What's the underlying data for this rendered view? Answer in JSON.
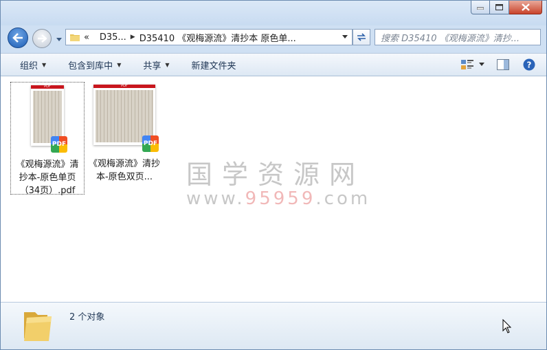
{
  "window": {
    "minimize_icon": "minimize-icon",
    "maximize_icon": "maximize-icon",
    "close_icon": "close-icon"
  },
  "nav": {
    "breadcrumb_overflow": "«",
    "crumb_1": "D35...",
    "crumb_2": "D35410 《观梅源流》清抄本 原色单...",
    "search_placeholder": "搜索 D35410 《观梅源流》清抄..."
  },
  "toolbar": {
    "organize": "组织",
    "include_library": "包含到库中",
    "share": "共享",
    "new_folder": "新建文件夹"
  },
  "files": [
    {
      "name": "《观梅源流》清抄本-原色单页（34页）.pdf",
      "badge": "PDF",
      "thumb_header": "PDF"
    },
    {
      "name": "《观梅源流》清抄本-原色双页...",
      "badge": "PDF",
      "thumb_header": "PDF"
    }
  ],
  "watermark": {
    "line1": "国学资源网",
    "line2_prefix": "www.",
    "line2_number": "95959",
    "line2_suffix": ".com"
  },
  "status": {
    "count": "2 个对象"
  },
  "colors": {
    "accent": "#1d5db4",
    "close": "#c9442b",
    "pdf_red": "#c8161d"
  }
}
